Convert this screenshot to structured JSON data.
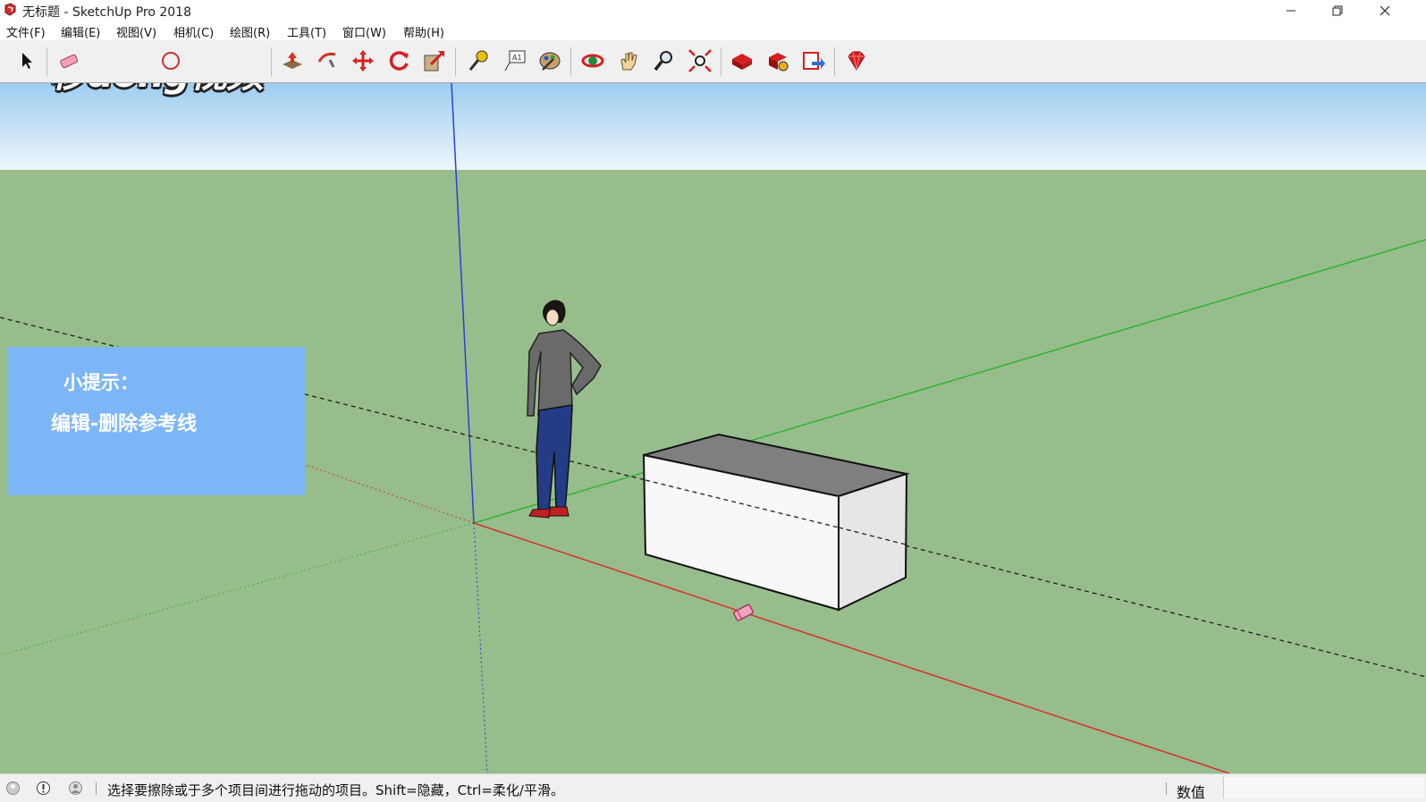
{
  "window": {
    "title": "无标题 - SketchUp Pro 2018"
  },
  "menu": [
    "文件(F)",
    "编辑(E)",
    "视图(V)",
    "相机(C)",
    "绘图(R)",
    "工具(T)",
    "窗口(W)",
    "帮助(H)"
  ],
  "toolbar": {
    "tools": [
      "select-icon",
      "eraser-icon",
      "paint-bucket-icon",
      "push-pull-icon",
      "follow-me-icon",
      "move-icon",
      "rotate-icon",
      "scale-icon",
      "tape-measure-icon",
      "text-icon",
      "paint-icon",
      "orbit-icon",
      "pan-icon",
      "zoom-icon",
      "zoom-extents-icon",
      "3d-warehouse-icon",
      "extension-warehouse-icon",
      "send-to-layout-icon",
      "ruby-icon"
    ]
  },
  "watermark": "秒dong视频",
  "tip": {
    "title": "小提示：",
    "text": "编辑-删除参考线"
  },
  "status": {
    "message": "选择要擦除或于多个项目间进行拖动的项目。Shift=隐藏，Ctrl=柔化/平滑。",
    "measure_label": "数值",
    "measure_value": ""
  },
  "colors": {
    "sky_top": "#9ecdf0",
    "sky_bottom": "#eef6fb",
    "ground": "#97bd8c",
    "tip_box": "#7db6f6",
    "x_axis": "#d6322a",
    "y_axis": "#2fb52f",
    "z_axis": "#2c3ed6"
  }
}
